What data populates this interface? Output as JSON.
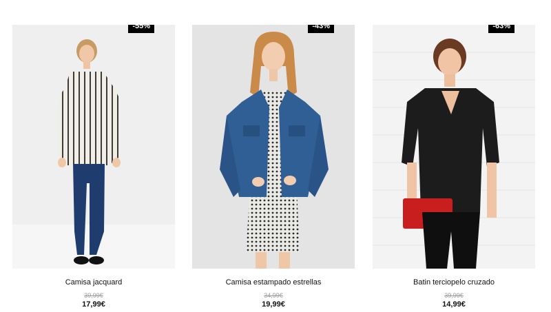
{
  "products": [
    {
      "name": "Camisa jacquard",
      "old_price": "39,99€",
      "price": "17,99€",
      "discount": "-55%"
    },
    {
      "name": "Camisa estampado estrellas",
      "old_price": "34,99€",
      "price": "19,99€",
      "discount": "-43%"
    },
    {
      "name": "Batin terciopelo cruzado",
      "old_price": "39,99€",
      "price": "14,99€",
      "discount": "-63%"
    }
  ],
  "colors": {
    "badge_bg": "#000000",
    "badge_text": "#ffffff",
    "old_price": "#9a9a9a"
  }
}
